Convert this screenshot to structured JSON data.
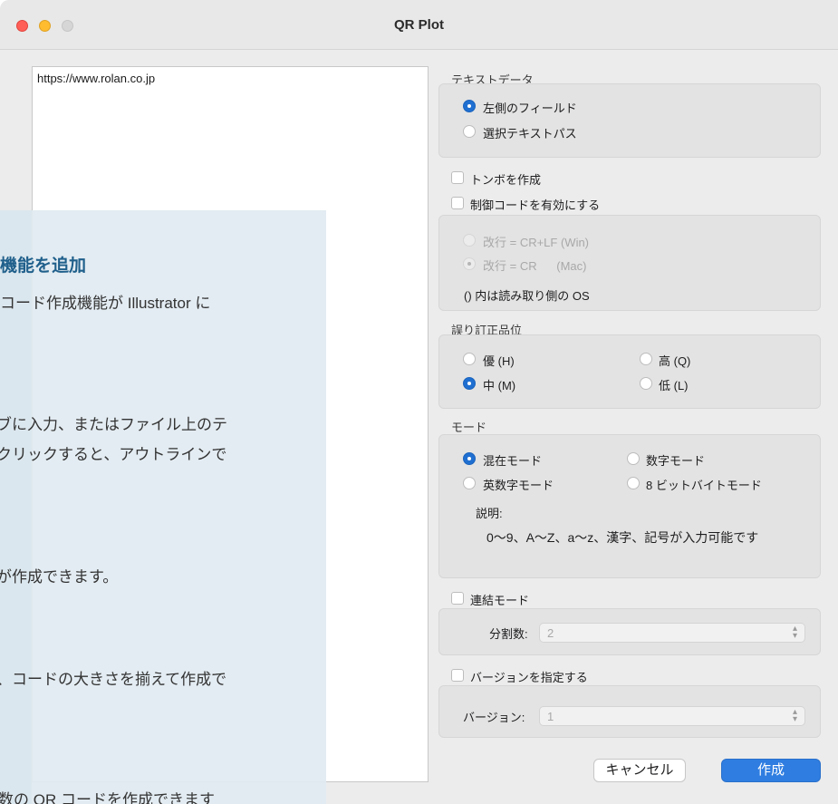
{
  "window": {
    "title": "QR Plot"
  },
  "textarea": {
    "value": "https://www.rolan.co.jp"
  },
  "overlay": {
    "heading": "機能を追加",
    "lines": [
      "コード作成機能が Illustrator に",
      "ブに入力、またはファイル上のテ",
      "クリックすると、アウトラインで",
      "が作成できます。",
      "、コードの大きさを揃えて作成で",
      "数の QR コードを作成できます"
    ]
  },
  "text_data": {
    "label": "テキストデータ",
    "options": [
      {
        "label": "左側のフィールド",
        "selected": true
      },
      {
        "label": "選択テキストパス",
        "selected": false
      }
    ]
  },
  "crop_marks": {
    "label": "トンボを作成",
    "checked": false
  },
  "control_code": {
    "label": "制御コードを有効にする",
    "checked": false,
    "options": [
      {
        "label": "改行 = CR+LF (Win)",
        "selected": false
      },
      {
        "label": "改行 = CR      (Mac)",
        "selected": true
      }
    ],
    "note": "() 内は読み取り側の OS"
  },
  "error_correction": {
    "label": "誤り訂正品位",
    "options": [
      {
        "label": "優 (H)",
        "selected": false
      },
      {
        "label": "高 (Q)",
        "selected": false
      },
      {
        "label": "中 (M)",
        "selected": true
      },
      {
        "label": "低 (L)",
        "selected": false
      }
    ]
  },
  "mode": {
    "label": "モード",
    "options": [
      {
        "label": "混在モード",
        "selected": true
      },
      {
        "label": "数字モード",
        "selected": false
      },
      {
        "label": "英数字モード",
        "selected": false
      },
      {
        "label": "8 ビットバイトモード",
        "selected": false
      }
    ],
    "desc_label": "説明:",
    "desc_text": "0〜9、A〜Z、a〜z、漢字、記号が入力可能です"
  },
  "structured_append": {
    "label": "連結モード",
    "checked": false,
    "split_label": "分割数:",
    "split_value": "2"
  },
  "version": {
    "label": "バージョンを指定する",
    "checked": false,
    "version_label": "バージョン:",
    "version_value": "1"
  },
  "buttons": {
    "cancel": "キャンセル",
    "ok": "作成"
  },
  "colors": {
    "accent": "#2f7de1",
    "overlay_heading": "#1f5f8b"
  }
}
